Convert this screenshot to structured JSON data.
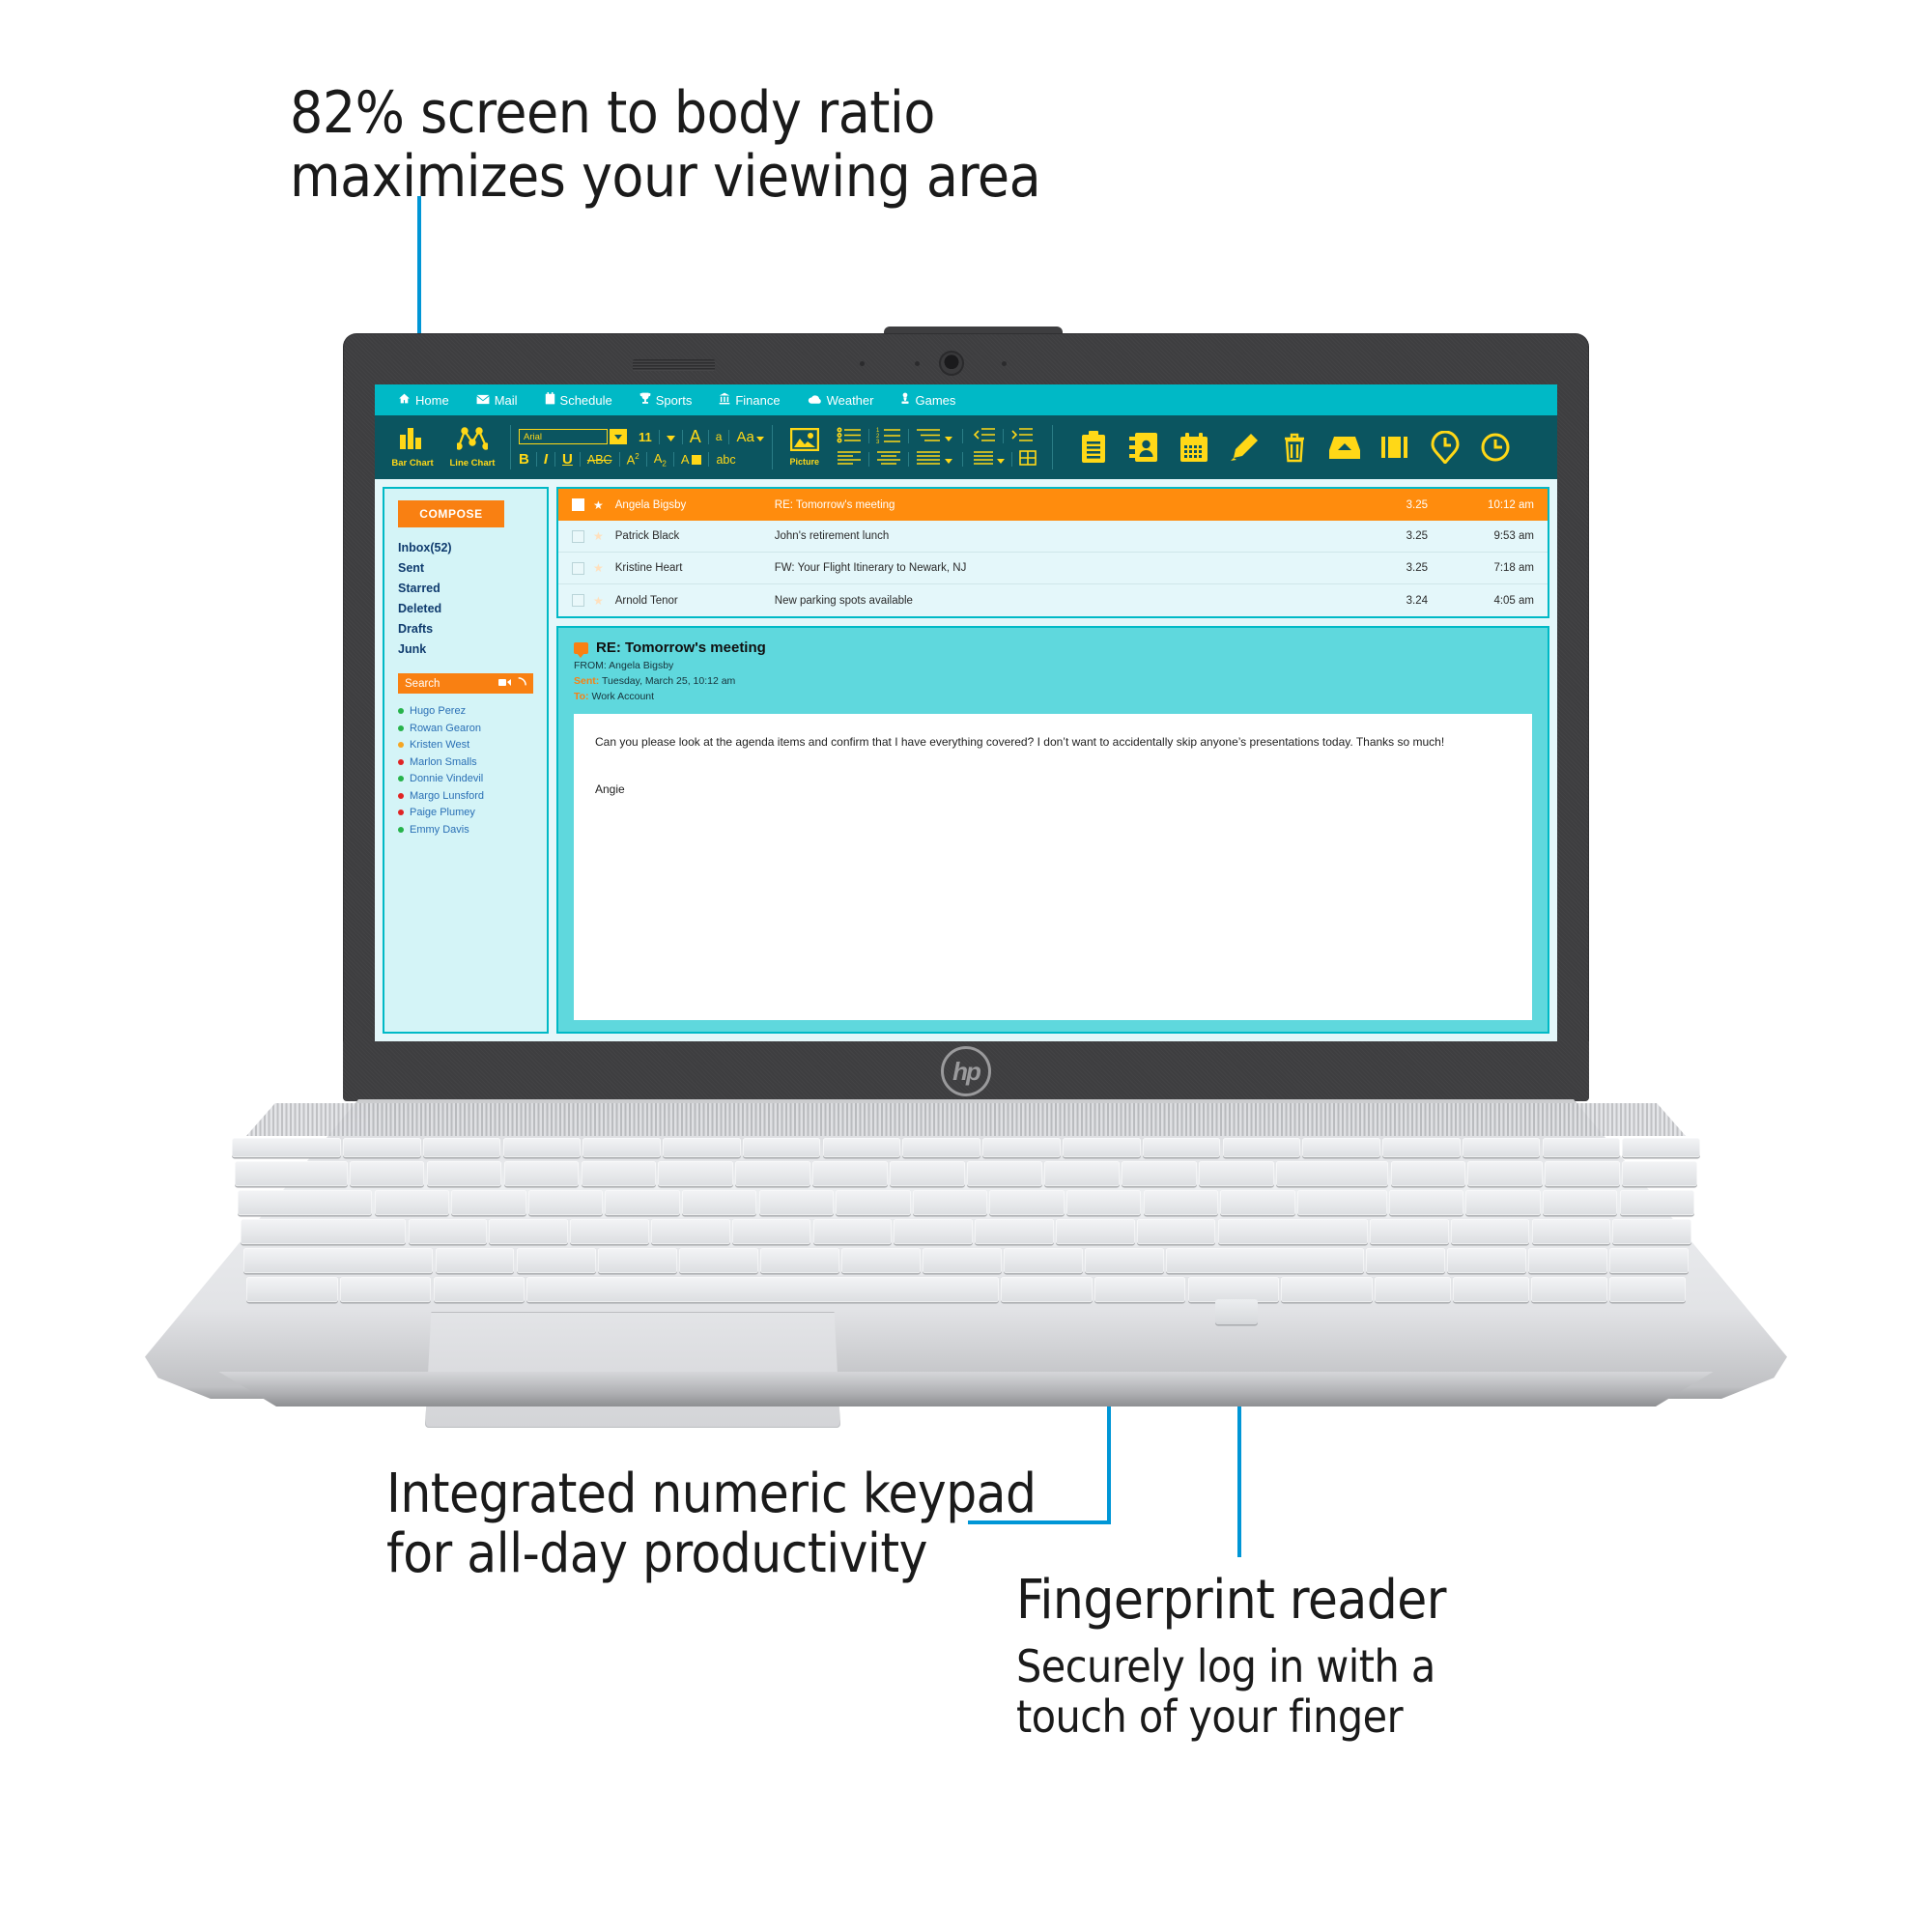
{
  "callouts": {
    "top": "82% screen to body ratio\nmaximizes your viewing area",
    "keypad": "Integrated numeric keypad\nfor all-day productivity",
    "fingerprint_title": "Fingerprint reader",
    "fingerprint_sub": "Securely log in with a\ntouch of your finger"
  },
  "brand": {
    "logo": "hp"
  },
  "accent_colors": {
    "leader_blue": "#0096d6",
    "menubar_teal": "#00b9c6",
    "toolbar_dark_teal": "#0b5560",
    "toolbar_yellow": "#ffd817",
    "selection_orange": "#ff8c0d",
    "compose_orange": "#f98012",
    "reader_teal": "#5fd8dd"
  },
  "screen": {
    "menubar": [
      {
        "label": "Home",
        "icon": "home-icon"
      },
      {
        "label": "Mail",
        "icon": "envelope-icon"
      },
      {
        "label": "Schedule",
        "icon": "calendar-icon"
      },
      {
        "label": "Sports",
        "icon": "trophy-icon"
      },
      {
        "label": "Finance",
        "icon": "bank-icon"
      },
      {
        "label": "Weather",
        "icon": "cloud-icon"
      },
      {
        "label": "Games",
        "icon": "chess-pawn-icon"
      }
    ],
    "toolbar": {
      "bar_chart_label": "Bar Chart",
      "line_chart_label": "Line Chart",
      "font_name": "Arial",
      "font_size": "11",
      "grow_font": "A",
      "shrink_font": "a",
      "change_case": "Aa",
      "bold": "B",
      "italic": "I",
      "underline": "U",
      "strikethrough": "ABC",
      "superscript": "A2",
      "subscript": "A2",
      "font_color": "A",
      "text_effects": "abc",
      "picture_label": "Picture",
      "icons": [
        "bullet-list-icon",
        "numbered-list-icon",
        "multilevel-list-icon",
        "decrease-indent-icon",
        "increase-indent-icon",
        "align-left-icon",
        "align-center-icon",
        "align-justify-icon",
        "line-spacing-icon",
        "table-icon",
        "clipboard-icon",
        "contacts-icon",
        "calendar-icon",
        "pencil-icon",
        "trash-icon",
        "inbox-icon",
        "briefcase-icon",
        "clock-pin-icon",
        "clock-icon"
      ]
    },
    "sidebar": {
      "compose_label": "COMPOSE",
      "folders": [
        "Inbox(52)",
        "Sent",
        "Starred",
        "Deleted",
        "Drafts",
        "Junk"
      ],
      "search_label": "Search",
      "search_icons": [
        "video-camera-icon",
        "phone-icon"
      ],
      "contacts": [
        {
          "name": "Hugo Perez",
          "status": "#26b34a"
        },
        {
          "name": "Rowan Gearon",
          "status": "#26b34a"
        },
        {
          "name": "Kristen West",
          "status": "#f5a623"
        },
        {
          "name": "Marlon Smalls",
          "status": "#e02424"
        },
        {
          "name": "Donnie Vindevil",
          "status": "#26b34a"
        },
        {
          "name": "Margo Lunsford",
          "status": "#e02424"
        },
        {
          "name": "Paige Plumey",
          "status": "#e02424"
        },
        {
          "name": "Emmy Davis",
          "status": "#26b34a"
        }
      ]
    },
    "maillist": [
      {
        "sender": "Angela Bigsby",
        "subject": "RE: Tomorrow's meeting",
        "date": "3.25",
        "time": "10:12 am",
        "selected": true
      },
      {
        "sender": "Patrick Black",
        "subject": "John's retirement lunch",
        "date": "3.25",
        "time": "9:53 am",
        "selected": false
      },
      {
        "sender": "Kristine Heart",
        "subject": "FW: Your Flight Itinerary to Newark, NJ",
        "date": "3.25",
        "time": "7:18 am",
        "selected": false
      },
      {
        "sender": "Arnold Tenor",
        "subject": "New parking spots available",
        "date": "3.24",
        "time": "4:05 am",
        "selected": false
      }
    ],
    "reader": {
      "title": "RE: Tomorrow's meeting",
      "from_label": "FROM:",
      "from_value": "Angela Bigsby",
      "sent_label": "Sent:",
      "sent_value": "Tuesday, March 25, 10:12 am",
      "to_label": "To:",
      "to_value": "Work Account",
      "body": "Can you please look at the agenda items and confirm that I have everything covered? I don’t want to accidentally skip anyone’s presentations today. Thanks so much!",
      "signature": "Angie"
    }
  }
}
